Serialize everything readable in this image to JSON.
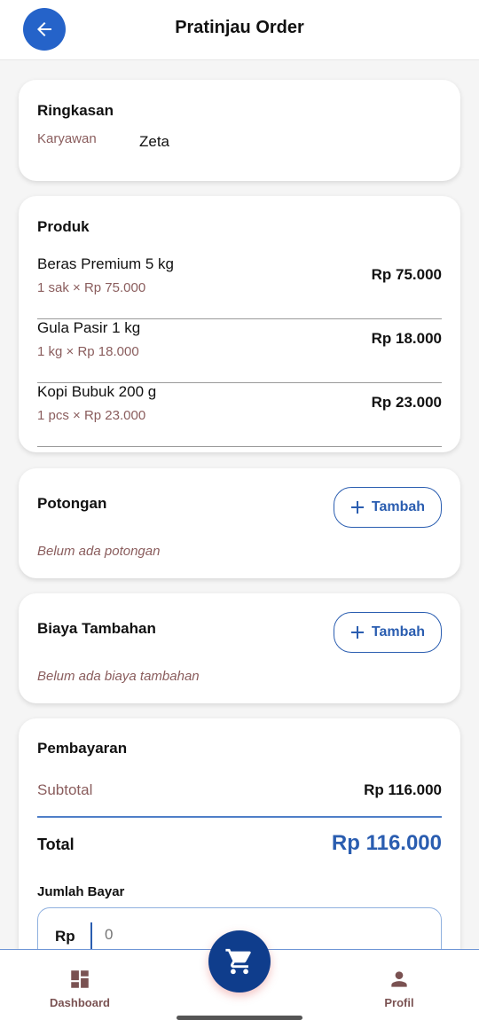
{
  "appbar": {
    "title": "Pratinjau Order",
    "back_icon": "arrow-left-icon"
  },
  "summary": {
    "title": "Ringkasan",
    "employee_label": "Karyawan",
    "employee_value": "Zeta"
  },
  "products": {
    "title": "Produk",
    "items": [
      {
        "name": "Beras Premium 5 kg",
        "detail": "1 sak × Rp 75.000",
        "price": "Rp 75.000"
      },
      {
        "name": "Gula Pasir 1 kg",
        "detail": "1 kg × Rp 18.000",
        "price": "Rp 18.000"
      },
      {
        "name": "Kopi Bubuk 200 g",
        "detail": "1 pcs × Rp 23.000",
        "price": "Rp 23.000"
      }
    ]
  },
  "discount": {
    "title": "Potongan",
    "add_label": "Tambah",
    "empty": "Belum ada potongan"
  },
  "extra_fee": {
    "title": "Biaya Tambahan",
    "add_label": "Tambah",
    "empty": "Belum ada biaya tambahan"
  },
  "payment": {
    "title": "Pembayaran",
    "subtotal_label": "Subtotal",
    "subtotal_value": "Rp 116.000",
    "total_label": "Total",
    "total_value": "Rp 116.000",
    "amount_label": "Jumlah Bayar",
    "amount_prefix": "Rp",
    "amount_placeholder": "0"
  },
  "bottom_nav": {
    "dashboard_label": "Dashboard",
    "profile_label": "Profil"
  },
  "colors": {
    "primary": "#2a5db0",
    "fab": "#0f3d8c",
    "muted": "#8a5d5d"
  }
}
